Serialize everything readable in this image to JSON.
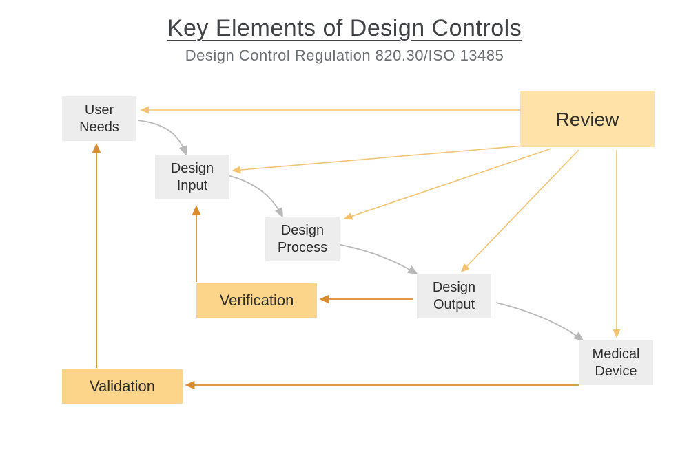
{
  "title": "Key Elements of Design Controls",
  "subtitle": "Design Control Regulation 820.30/ISO 13485",
  "boxes": {
    "userNeeds": "User Needs",
    "designInput": "Design Input",
    "designProcess": "Design Process",
    "designOutput": "Design Output",
    "medicalDevice": "Medical Device",
    "review": "Review",
    "verification": "Verification",
    "validation": "Validation"
  },
  "colors": {
    "greyBox": "#ededed",
    "yellowBox": "#fcd58a",
    "reviewBox": "#ffe2a8",
    "greyArrow": "#b8b8b8",
    "orangeArrow": "#d98c2e",
    "lightOrangeArrow": "#f4c271"
  },
  "arrows": [
    {
      "from": "userNeeds",
      "to": "designInput",
      "style": "grey",
      "shape": "curve"
    },
    {
      "from": "designInput",
      "to": "designProcess",
      "style": "grey",
      "shape": "curve"
    },
    {
      "from": "designProcess",
      "to": "designOutput",
      "style": "grey",
      "shape": "curve"
    },
    {
      "from": "designOutput",
      "to": "medicalDevice",
      "style": "grey",
      "shape": "curve"
    },
    {
      "from": "review",
      "to": "userNeeds",
      "style": "lightOrange",
      "shape": "straight"
    },
    {
      "from": "review",
      "to": "designInput",
      "style": "lightOrange",
      "shape": "straight"
    },
    {
      "from": "review",
      "to": "designProcess",
      "style": "lightOrange",
      "shape": "straight"
    },
    {
      "from": "review",
      "to": "designOutput",
      "style": "lightOrange",
      "shape": "straight"
    },
    {
      "from": "review",
      "to": "medicalDevice",
      "style": "lightOrange",
      "shape": "straight"
    },
    {
      "from": "designOutput",
      "to": "verification",
      "style": "orange",
      "shape": "straight"
    },
    {
      "from": "verification",
      "to": "designInput",
      "style": "orange",
      "shape": "straight"
    },
    {
      "from": "medicalDevice",
      "to": "validation",
      "style": "orange",
      "shape": "straight"
    },
    {
      "from": "validation",
      "to": "userNeeds",
      "style": "orange",
      "shape": "straight"
    }
  ]
}
